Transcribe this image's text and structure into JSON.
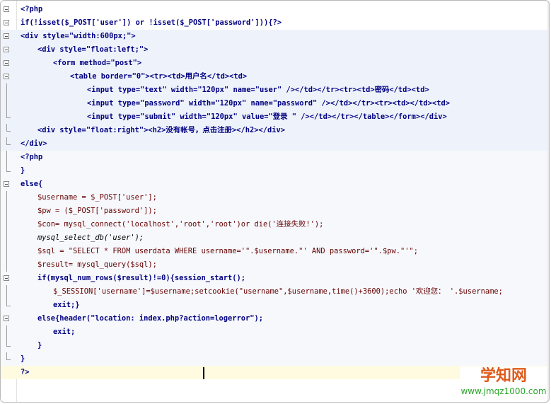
{
  "editor": {
    "lines": [
      {
        "t": "<?php"
      },
      {
        "t": "if(!isset($_POST['user']) or !isset($_POST['password'])){?>"
      },
      {
        "t": "<div style=\"width:600px;\">"
      },
      {
        "t": "<div style=\"float:left;\">"
      },
      {
        "t": "<form method=\"post\">"
      },
      {
        "t": "<table border=\"0\"><tr><td>用户名</td><td>"
      },
      {
        "t": "<input type=\"text\" width=\"120px\" name=\"user\" /></td></tr><tr><td>密码</td><td>"
      },
      {
        "t": "<input type=\"password\" width=\"120px\" name=\"password\" /></td></tr><tr><td></td><td>"
      },
      {
        "t": "<input type=\"submit\" width=\"120px\" value=\"登录 \" /></td></tr></table></form></div>"
      },
      {
        "t": "<div style=\"float:right\"><h2>没有帐号，点击注册></h2></div>"
      },
      {
        "t": "</div>"
      },
      {
        "t": "<?php"
      },
      {
        "t": "}"
      },
      {
        "t": "else{"
      },
      {
        "t": "$username = $_POST['user'];"
      },
      {
        "t": "$pw = ($_POST['password']);"
      },
      {
        "t": "$con= mysql_connect('localhost','root','root')or die('连接失败!');"
      },
      {
        "t": "mysql_select_db('user');"
      },
      {
        "t": "$sql = \"SELECT * FROM userdata WHERE username='\".$username.\"' AND password='\".$pw.\"'\";"
      },
      {
        "t": "$result= mysql_query($sql);"
      },
      {
        "t": "if(mysql_num_rows($result)!=0){session_start();"
      },
      {
        "t": "$_SESSION['username']=$username;setcookie(\"username\",$username,time()+3600);echo '欢迎您： '.$username;"
      },
      {
        "t": "exit;}"
      },
      {
        "t": "else{header(\"location: index.php?action=logerror\");"
      },
      {
        "t": "exit;"
      },
      {
        "t": "}"
      },
      {
        "t": "}"
      },
      {
        "t": "?>"
      }
    ]
  },
  "watermark": {
    "title": "学知网",
    "url": "www.jmqz1000.com"
  },
  "colors": {
    "keyword": "#000080",
    "string": "#008000",
    "watermark_title": "#e05a1a",
    "watermark_url": "#2aa52a",
    "current_line": "#fffbe0"
  }
}
